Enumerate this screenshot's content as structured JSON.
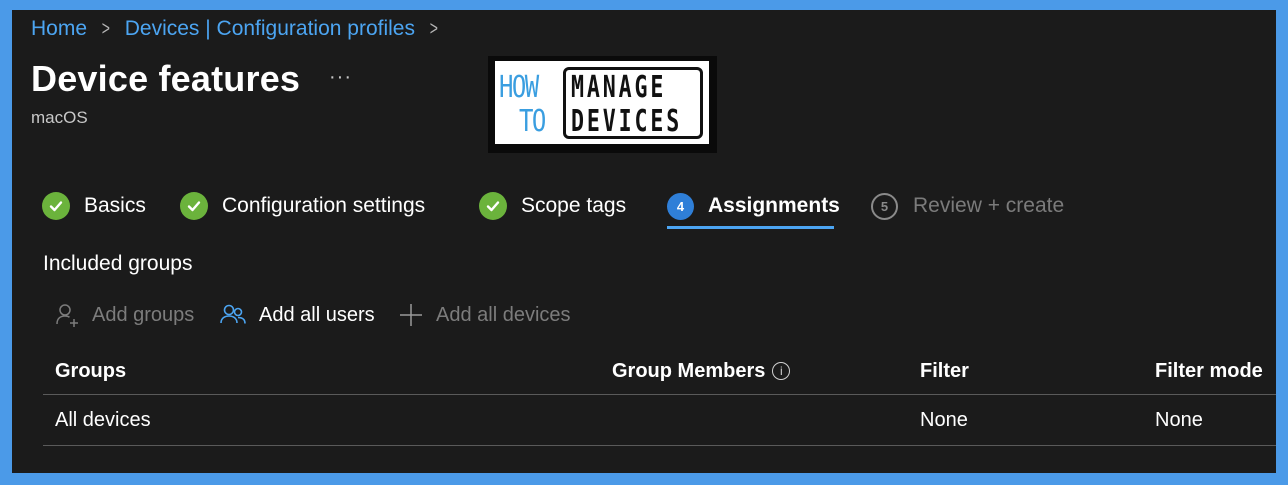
{
  "breadcrumb": {
    "items": [
      "Home",
      "Devices | Configuration profiles"
    ],
    "separator": ">"
  },
  "page": {
    "title": "Device features",
    "more_label": "···",
    "subtitle": "macOS"
  },
  "logo": {
    "word1": "HOW",
    "word2": "TO",
    "word3": "MANAGE",
    "word4": "DEVICES"
  },
  "wizard": {
    "steps": [
      {
        "label": "Basics",
        "state": "completed",
        "icon": "check-circle-icon"
      },
      {
        "label": "Configuration settings",
        "state": "completed",
        "icon": "check-circle-icon"
      },
      {
        "label": "Scope tags",
        "state": "completed",
        "icon": "check-circle-icon"
      },
      {
        "label": "Assignments",
        "number": "4",
        "state": "current"
      },
      {
        "label": "Review + create",
        "number": "5",
        "state": "disabled"
      }
    ]
  },
  "assignments": {
    "section_title": "Included groups",
    "toolbar": {
      "add_groups": "Add groups",
      "add_all_users": "Add all users",
      "add_all_devices": "Add all devices"
    },
    "table": {
      "columns": [
        "Groups",
        "Group Members",
        "Filter",
        "Filter mode"
      ],
      "info_icon": "info-icon",
      "rows": [
        {
          "group": "All devices",
          "members": "",
          "filter": "None",
          "filter_mode": "None"
        }
      ]
    }
  },
  "colors": {
    "page_border": "#4b9ae8",
    "background": "#1b1b1b",
    "link": "#4ca5f2",
    "success": "#6bb33c",
    "active_step": "#2f7fd8",
    "disabled_text": "#7b7b7b"
  }
}
